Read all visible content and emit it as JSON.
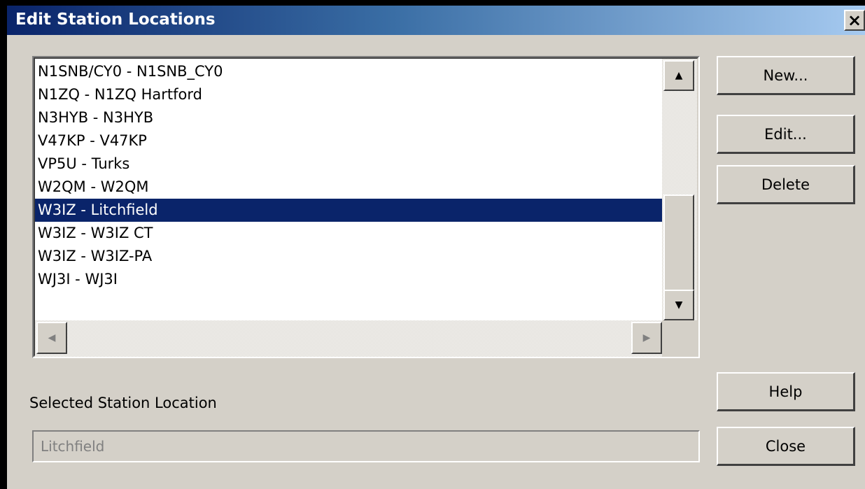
{
  "window": {
    "title": "Edit Station Locations",
    "close_glyph": "✕"
  },
  "station_list": {
    "items": [
      "N1SNB/CY0 - N1SNB_CY0",
      "N1ZQ - N1ZQ Hartford",
      "N3HYB - N3HYB",
      "V47KP - V47KP",
      "VP5U - Turks",
      "W2QM - W2QM",
      "W3IZ - Litchfield",
      "W3IZ - W3IZ CT",
      "W3IZ - W3IZ-PA",
      "WJ3I - WJ3I"
    ],
    "selected_index": 6
  },
  "buttons": {
    "new_label": "New...",
    "edit_label": "Edit...",
    "delete_label": "Delete",
    "help_label": "Help",
    "close_label": "Close"
  },
  "selected": {
    "label": "Selected Station Location",
    "value": "Litchfield"
  },
  "colors": {
    "selection": "#0a246a",
    "face": "#d4d0c8"
  }
}
